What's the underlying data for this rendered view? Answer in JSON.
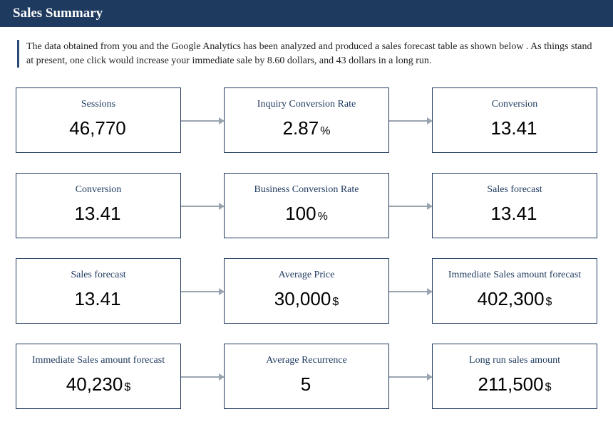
{
  "header": {
    "title": "Sales Summary"
  },
  "description": "The data obtained from you and the Google Analytics has been analyzed and produced a sales forecast table as shown below . As things stand at present, one click would increase your immediate sale by 8.60 dollars, and 43 dollars in a long run.",
  "cards": [
    {
      "title": "Sessions",
      "value": "46,770",
      "unit": ""
    },
    {
      "title": "Inquiry Conversion Rate",
      "value": "2.87",
      "unit": "%"
    },
    {
      "title": "Conversion",
      "value": "13.41",
      "unit": ""
    },
    {
      "title": "Conversion",
      "value": "13.41",
      "unit": ""
    },
    {
      "title": "Business Conversion Rate",
      "value": "100",
      "unit": "%"
    },
    {
      "title": "Sales forecast",
      "value": "13.41",
      "unit": ""
    },
    {
      "title": "Sales forecast",
      "value": "13.41",
      "unit": ""
    },
    {
      "title": "Average Price",
      "value": "30,000",
      "unit": "$"
    },
    {
      "title": "Immediate Sales amount forecast",
      "value": "402,300",
      "unit": "$"
    },
    {
      "title": "Immediate Sales amount forecast",
      "value": "40,230 ",
      "unit": "$"
    },
    {
      "title": "Average Recurrence",
      "value": "5",
      "unit": ""
    },
    {
      "title": "Long run sales amount",
      "value": "211,500",
      "unit": "$"
    }
  ]
}
